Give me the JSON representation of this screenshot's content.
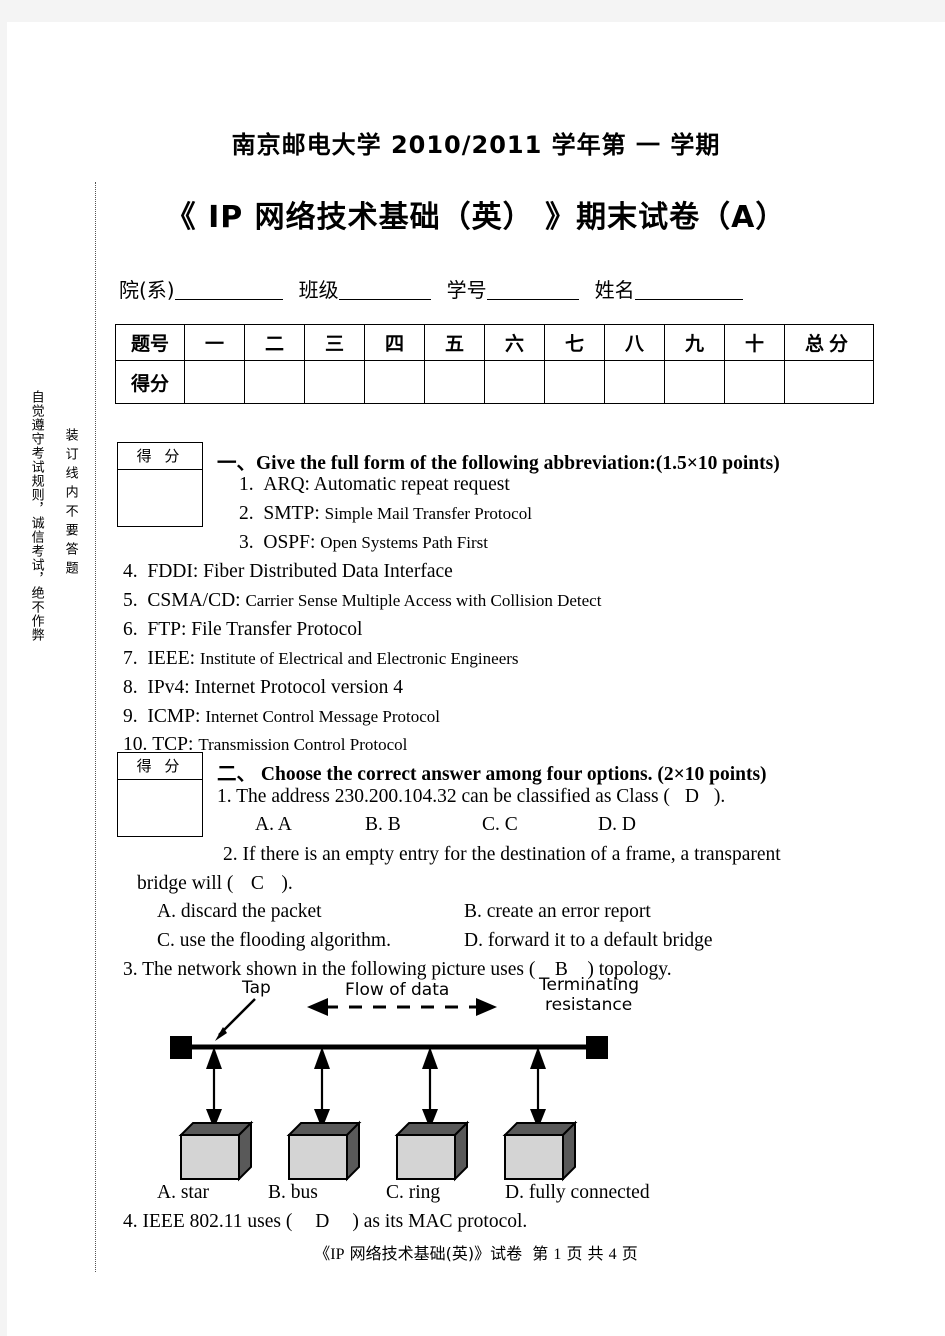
{
  "header": {
    "university_line": "南京邮电大学 2010/2011 学年第 一 学期",
    "exam_title": "《 IP 网络技术基础（英） 》期末试卷（A）"
  },
  "identity_fields": [
    {
      "label": "院(系)"
    },
    {
      "label": "班级"
    },
    {
      "label": "学号"
    },
    {
      "label": "姓名"
    }
  ],
  "score_table": {
    "row_label_question": "题号",
    "row_label_score": "得分",
    "columns": [
      "一",
      "二",
      "三",
      "四",
      "五",
      "六",
      "七",
      "八",
      "九",
      "十"
    ],
    "total_label": "总分"
  },
  "side_text": {
    "outer": "自觉遵守考试规则，诚信考试，绝不作弊",
    "inner": "装订线内不要答题"
  },
  "defen_label": "得 分",
  "section1": {
    "marker": "一、",
    "heading": "Give the full form of the following abbreviation:(1.5×10 points)",
    "items": [
      {
        "num": "1.",
        "abbr": "ARQ:",
        "expansion": "Automatic repeat request",
        "size": "large"
      },
      {
        "num": "2.",
        "abbr": "SMTP:",
        "expansion": "Simple Mail Transfer Protocol",
        "size": "small"
      },
      {
        "num": "3.",
        "abbr": "OSPF:",
        "expansion": "Open Systems Path First",
        "size": "small"
      },
      {
        "num": "4.",
        "abbr": "FDDI:",
        "expansion": "Fiber Distributed Data Interface",
        "size": "large"
      },
      {
        "num": "5.",
        "abbr": "CSMA/CD:",
        "expansion": "Carrier Sense Multiple Access with Collision Detect",
        "size": "small"
      },
      {
        "num": "6.",
        "abbr": "FTP:",
        "expansion": "File Transfer Protocol",
        "size": "large"
      },
      {
        "num": "7.",
        "abbr": "IEEE:",
        "expansion": "Institute of Electrical and Electronic Engineers",
        "size": "small"
      },
      {
        "num": "8.",
        "abbr": "IPv4:",
        "expansion": "Internet Protocol version 4",
        "size": "large"
      },
      {
        "num": "9.",
        "abbr": "ICMP:",
        "expansion": "Internet Control Message Protocol",
        "size": "small"
      },
      {
        "num": "10.",
        "abbr": "TCP:",
        "expansion": "Transmission Control Protocol",
        "size": "small"
      }
    ]
  },
  "section2": {
    "marker": "二、",
    "heading": "Choose the correct answer among four options. (2×10 points)",
    "q1": {
      "text": "1. The address 230.200.104.32 can be classified as Class (",
      "answer": "D",
      "tail": ").",
      "options": [
        "A. A",
        "B. B",
        "C. C",
        "D. D"
      ]
    },
    "q2": {
      "line1": "2. If there is an empty entry for the destination of a frame, a transparent",
      "line2_pre": "bridge will (",
      "answer": "C",
      "line2_post": ").",
      "optA": "A. discard the packet",
      "optB": "B. create an error report",
      "optC": "C. use the flooding algorithm.",
      "optD": "D. forward it to a default bridge"
    },
    "q3": {
      "pre": "3. The network shown in the following picture uses (",
      "answer": "B",
      "post": ") topology.",
      "figure": {
        "label_tap": "Tap",
        "label_flow": "Flow of data",
        "label_terminating_line1": "Terminating",
        "label_terminating_line2": "resistance"
      },
      "options": [
        "A. star",
        "B. bus",
        "C. ring",
        "D. fully connected"
      ]
    },
    "q4": {
      "pre": "4. IEEE 802.11 uses (",
      "answer": "D",
      "post": ") as its MAC protocol."
    }
  },
  "footer": {
    "title_open": "《",
    "title_en": "IP",
    "title_cn": "网络技术基础(英)",
    "title_close": "》试卷",
    "page_pre": "第",
    "page_num": "1",
    "page_mid": "页 共",
    "page_total": "4",
    "page_suf": "页"
  }
}
